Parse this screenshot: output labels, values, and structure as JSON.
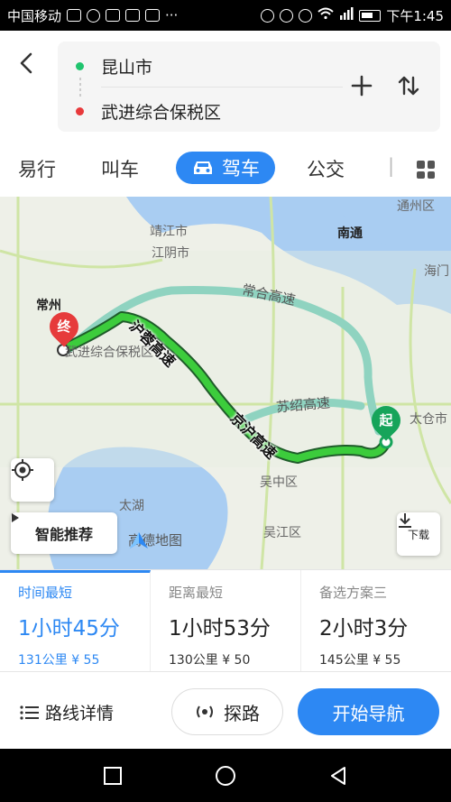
{
  "status_bar": {
    "carrier": "中国移动",
    "time": "下午1:45"
  },
  "route": {
    "origin": "昆山市",
    "destination": "武进综合保税区"
  },
  "tabs": [
    {
      "label": "易行"
    },
    {
      "label": "叫车"
    },
    {
      "label": "驾车"
    },
    {
      "label": "公交"
    }
  ],
  "map": {
    "places": {
      "jingjiang": "靖江市",
      "jiangyin": "江阴市",
      "nantong": "南通",
      "changzhou": "常州",
      "wujin_zone": "武进综合保税区",
      "taihu": "太湖",
      "wuzhong": "吴中区",
      "wujiang": "吴江区",
      "haimen": "海门",
      "tongzhou": "通州区",
      "taicang": "太仓市"
    },
    "roads": {
      "changhe": "常合高速",
      "sushao": "苏绍高速",
      "hurong": "沪蓉高速",
      "jinghu": "京沪高速"
    },
    "start_marker": "起",
    "end_marker": "终",
    "smart_recommend": "智能推荐",
    "brand": "高德地图",
    "download": "下载",
    "route_color": "#1fb34a",
    "alt_route_color": "#8fd3c0"
  },
  "options": [
    {
      "label": "时间最短",
      "time": "1小时45分",
      "distance": "131公里",
      "fee": "¥ 55",
      "active": true
    },
    {
      "label": "距离最短",
      "time": "1小时53分",
      "distance": "130公里",
      "fee": "¥ 50",
      "active": false
    },
    {
      "label": "备选方案三",
      "time": "2小时3分",
      "distance": "145公里",
      "fee": "¥ 55",
      "active": false
    }
  ],
  "actions": {
    "details": "路线详情",
    "explore": "探路",
    "start_nav": "开始导航"
  },
  "accent_color": "#2d88f3"
}
